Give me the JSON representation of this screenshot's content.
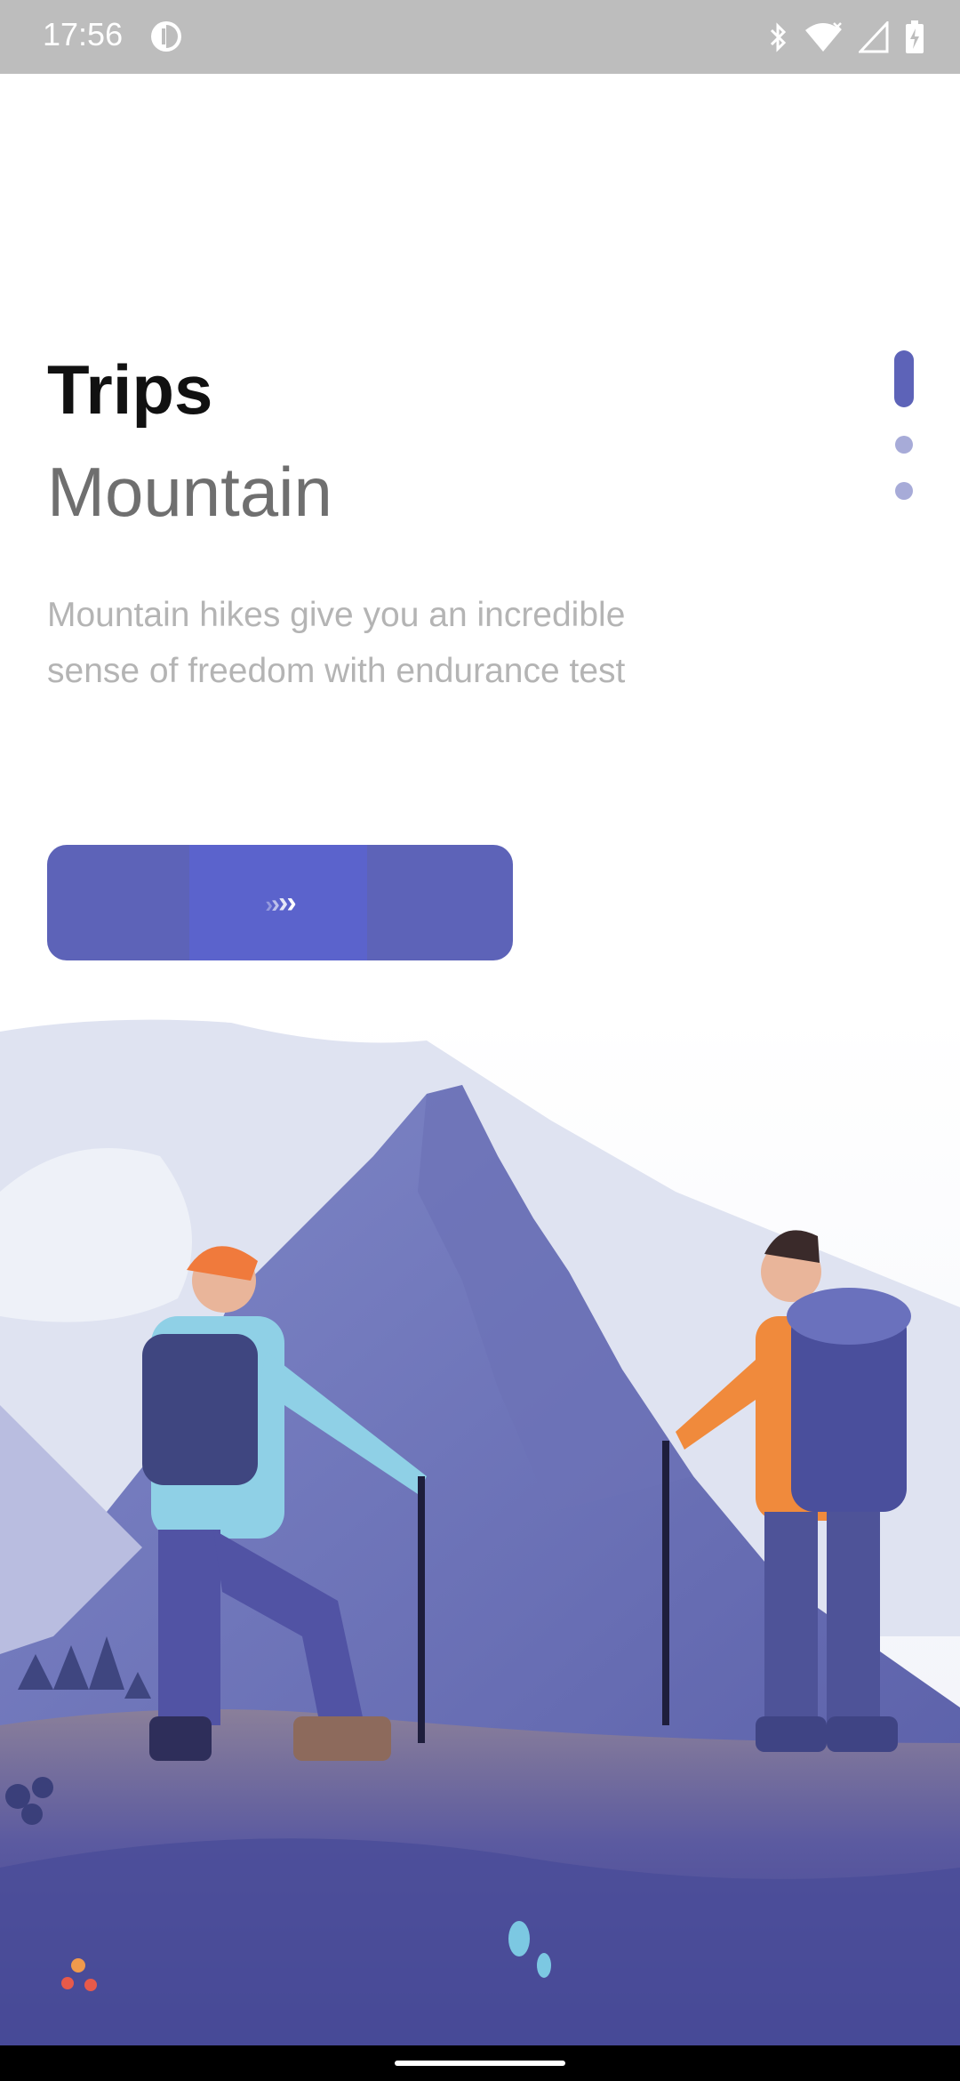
{
  "status_bar": {
    "time": "17:56",
    "icons": [
      "app-notification-icon",
      "bluetooth-icon",
      "wifi-icon",
      "signal-icon",
      "battery-icon"
    ]
  },
  "content": {
    "title": "Trips",
    "subtitle": "Mountain",
    "description": "Mountain hikes give you an incredible sense of freedom with endurance test"
  },
  "indicator": {
    "pages": 3,
    "active_index": 0
  },
  "next_button": {
    "icon": "chevron-arrows-icon",
    "arrows": [
      "›",
      "›",
      "›",
      "›"
    ]
  },
  "illustration": {
    "subject": "hikers-mountain-illustration"
  },
  "colors": {
    "accent": "#5d63b8",
    "indicator_inactive": "#a7abd8",
    "title": "#111111",
    "subtitle": "#6f6f6f",
    "description": "#b4b4b4",
    "status_bar": "#bdbdbd"
  }
}
